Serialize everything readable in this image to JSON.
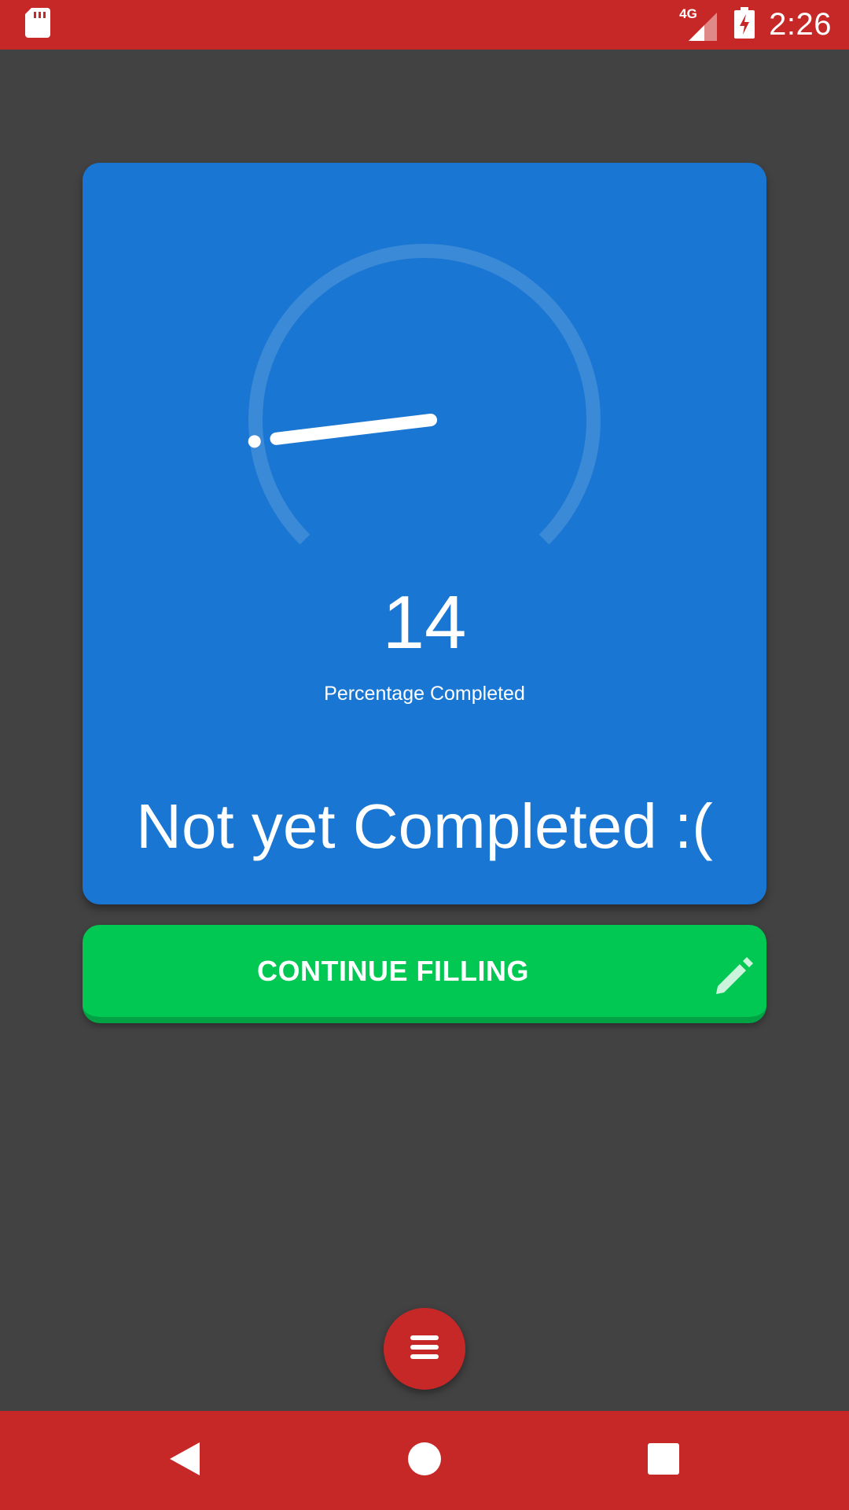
{
  "status_bar": {
    "time": "2:26",
    "network_type": "4G",
    "icons": [
      "sd-card-icon",
      "signal-icon",
      "battery-charging-icon"
    ]
  },
  "gauge": {
    "value": "14",
    "percent": 14,
    "caption": "Percentage Completed"
  },
  "card": {
    "message": "Not yet Completed :("
  },
  "continue_button": {
    "label": "CONTINUE FILLING",
    "icon": "pencil-icon"
  },
  "fab": {
    "icon": "menu-icon"
  },
  "nav_bar": {
    "icons": [
      "back-icon",
      "home-icon",
      "recents-icon"
    ]
  },
  "colors": {
    "status_bar": "#c62828",
    "background": "#424242",
    "card": "#1976d2",
    "button": "#00c853",
    "fab": "#c62828"
  }
}
